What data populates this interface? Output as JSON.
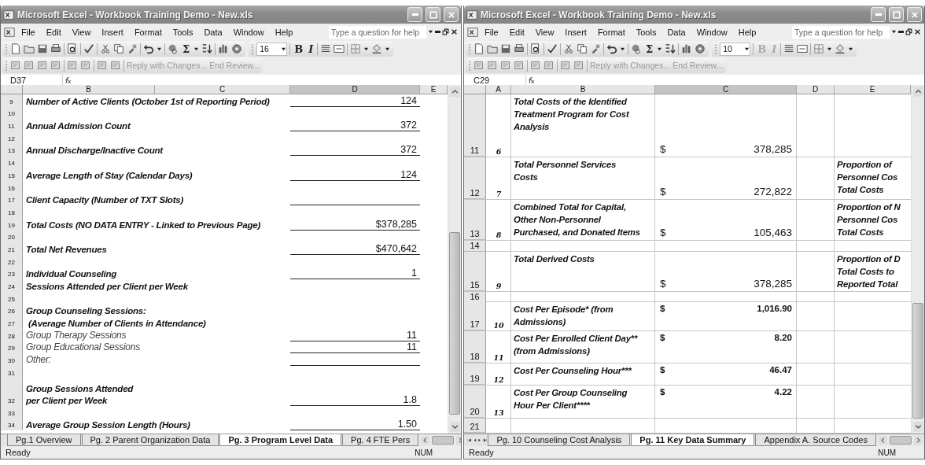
{
  "windows": [
    {
      "title": "Microsoft Excel - Workbook Training Demo - New.xls",
      "menu": [
        "File",
        "Edit",
        "View",
        "Insert",
        "Format",
        "Tools",
        "Data",
        "Window",
        "Help"
      ],
      "help_placeholder": "Type a question for help",
      "sum_glyph": "Σ",
      "font_size": "16",
      "format_buttons": [
        {
          "label": "B",
          "kind": "bold",
          "disabled": false
        },
        {
          "label": "I",
          "kind": "italic",
          "disabled": false
        }
      ],
      "review": [
        "Reply with Changes...",
        "End Review..."
      ],
      "name_box": "D37",
      "columns": [
        {
          "label": "B",
          "selected": false
        },
        {
          "label": "C",
          "selected": false
        },
        {
          "label": "D",
          "selected": true
        },
        {
          "label": "E",
          "selected": false
        }
      ],
      "rows": [
        {
          "num": "9",
          "kind": "item",
          "label": "Number of Active Clients (October 1st of Reporting Period)",
          "value": "124",
          "underline": true
        },
        {
          "num": "10",
          "kind": "blank"
        },
        {
          "num": "11",
          "kind": "item",
          "label": "Annual Admission Count",
          "value": "372",
          "underline": true
        },
        {
          "num": "12",
          "kind": "blank"
        },
        {
          "num": "13",
          "kind": "item",
          "label": "Annual Discharge/Inactive Count",
          "value": "372",
          "underline": true
        },
        {
          "num": "14",
          "kind": "blank"
        },
        {
          "num": "15",
          "kind": "item",
          "label": "Average Length of Stay (Calendar Days)",
          "value": "124",
          "underline": true
        },
        {
          "num": "16",
          "kind": "blank"
        },
        {
          "num": "17",
          "kind": "item",
          "label": "Client Capacity (Number of TXT Slots)",
          "underline": true
        },
        {
          "num": "18",
          "kind": "blank"
        },
        {
          "num": "19",
          "kind": "item",
          "label": "Total Costs (NO DATA ENTRY - Linked to Previous Page)",
          "value": "$378,285",
          "underline": true
        },
        {
          "num": "20",
          "kind": "blank"
        },
        {
          "num": "21",
          "kind": "item",
          "label": "Total Net Revenues",
          "value": "$470,642",
          "underline": true
        },
        {
          "num": "22",
          "kind": "blank"
        },
        {
          "num": "23",
          "kind": "item",
          "label": "Individual Counseling",
          "value": "1",
          "underline": true
        },
        {
          "num": "24",
          "kind": "item",
          "label": "Sessions Attended per Client per Week",
          "underline": false
        },
        {
          "num": "25",
          "kind": "blank"
        },
        {
          "num": "26",
          "kind": "item",
          "label": "Group Counseling Sessions:",
          "underline": false
        },
        {
          "num": "27",
          "kind": "item",
          "label": " (Average Number of Clients in Attendance)",
          "underline": false
        },
        {
          "num": "28",
          "kind": "sub",
          "label": "Group Therapy Sessions",
          "value": "11",
          "underline": true
        },
        {
          "num": "29",
          "kind": "sub",
          "label": "Group Educational Sessions",
          "value": "11",
          "underline": true
        },
        {
          "num": "30",
          "kind": "sub",
          "label": "Other:",
          "underline": true
        },
        {
          "num": "31",
          "kind": "blank"
        },
        {
          "num": "32",
          "kind": "item",
          "label": "Group Sessions Attended\nper Client per Week",
          "value": "1.8",
          "underline": true
        },
        {
          "num": "33",
          "kind": "blank"
        },
        {
          "num": "34",
          "kind": "item",
          "label": "Average Group Session Length (Hours)",
          "value": "1.50",
          "underline": true
        }
      ],
      "tabs": [
        {
          "label": "Pg.1 Overview",
          "selected": false
        },
        {
          "label": "Pg. 2 Parent Organization Data",
          "selected": false
        },
        {
          "label": "Pg. 3 Program Level Data",
          "selected": true
        },
        {
          "label": "Pg. 4 FTE Pers",
          "selected": false
        }
      ],
      "status": "Ready",
      "num": "NUM"
    },
    {
      "title": "Microsoft Excel - Workbook Training Demo - New.xls",
      "menu": [
        "File",
        "Edit",
        "View",
        "Insert",
        "Format",
        "Tools",
        "Data",
        "Window",
        "Help"
      ],
      "help_placeholder": "Type a question for help",
      "sum_glyph": "Σ",
      "font_size": "10",
      "format_buttons": [
        {
          "label": "B",
          "kind": "bold",
          "disabled": true
        },
        {
          "label": "I",
          "kind": "italic",
          "disabled": true
        }
      ],
      "review": [
        "Reply with Changes...",
        "End Review..."
      ],
      "name_box": "C29",
      "columns": [
        {
          "label": "A",
          "selected": false
        },
        {
          "label": "B",
          "selected": false
        },
        {
          "label": "C",
          "selected": true
        },
        {
          "label": "D",
          "selected": false
        },
        {
          "label": "E",
          "selected": false
        }
      ],
      "rows": [
        {
          "num": "11",
          "kind": "total",
          "a": "6",
          "b": "Total Costs of the Identified\nTreatment Program for Cost\nAnalysis",
          "sign": "$",
          "amount": "378,285"
        },
        {
          "num": "12",
          "kind": "total",
          "a": "7",
          "b": "Total Personnel Services\nCosts",
          "sign": "$",
          "amount": "272,822",
          "e": "Proportion of\nPersonnel Cos\nTotal Costs"
        },
        {
          "num": "13",
          "kind": "total",
          "a": "8",
          "b": "Combined Total for Capital,\nOther Non-Personnel\nPurchased, and Donated Items",
          "sign": "$",
          "amount": "105,463",
          "e": "Proportion of N\nPersonnel Cos\nTotal Costs"
        },
        {
          "num": "14",
          "kind": "blank"
        },
        {
          "num": "15",
          "kind": "total",
          "a": "9",
          "b": "Total Derived Costs",
          "sign": "$",
          "amount": "378,285",
          "e": "Proportion of D\nTotal Costs to\nReported Total"
        },
        {
          "num": "16",
          "kind": "blank"
        },
        {
          "num": "17",
          "kind": "rate",
          "a": "10",
          "b": "Cost Per Episode* (from\nAdmissions)",
          "sign": "$",
          "amount": "1,016.90"
        },
        {
          "num": "18",
          "kind": "rate",
          "a": "11",
          "b": "Cost Per Enrolled Client Day**\n(from Admissions)",
          "sign": "$",
          "amount": "8.20"
        },
        {
          "num": "19",
          "kind": "rate",
          "a": "12",
          "b": "Cost Per Counseling Hour***",
          "sign": "$",
          "amount": "46.47"
        },
        {
          "num": "20",
          "kind": "rate",
          "a": "13",
          "b": "Cost Per Group Counseling\nHour Per Client****",
          "sign": "$",
          "amount": "4.22"
        },
        {
          "num": "21",
          "kind": "blank"
        }
      ],
      "tabs": [
        {
          "label": "Pg. 10 Counseling Cost Analysis",
          "selected": false
        },
        {
          "label": "Pg. 11 Key Data Summary",
          "selected": true
        },
        {
          "label": "Appendix A. Source Codes",
          "selected": false
        }
      ],
      "status": "Ready",
      "num": "NUM"
    }
  ]
}
